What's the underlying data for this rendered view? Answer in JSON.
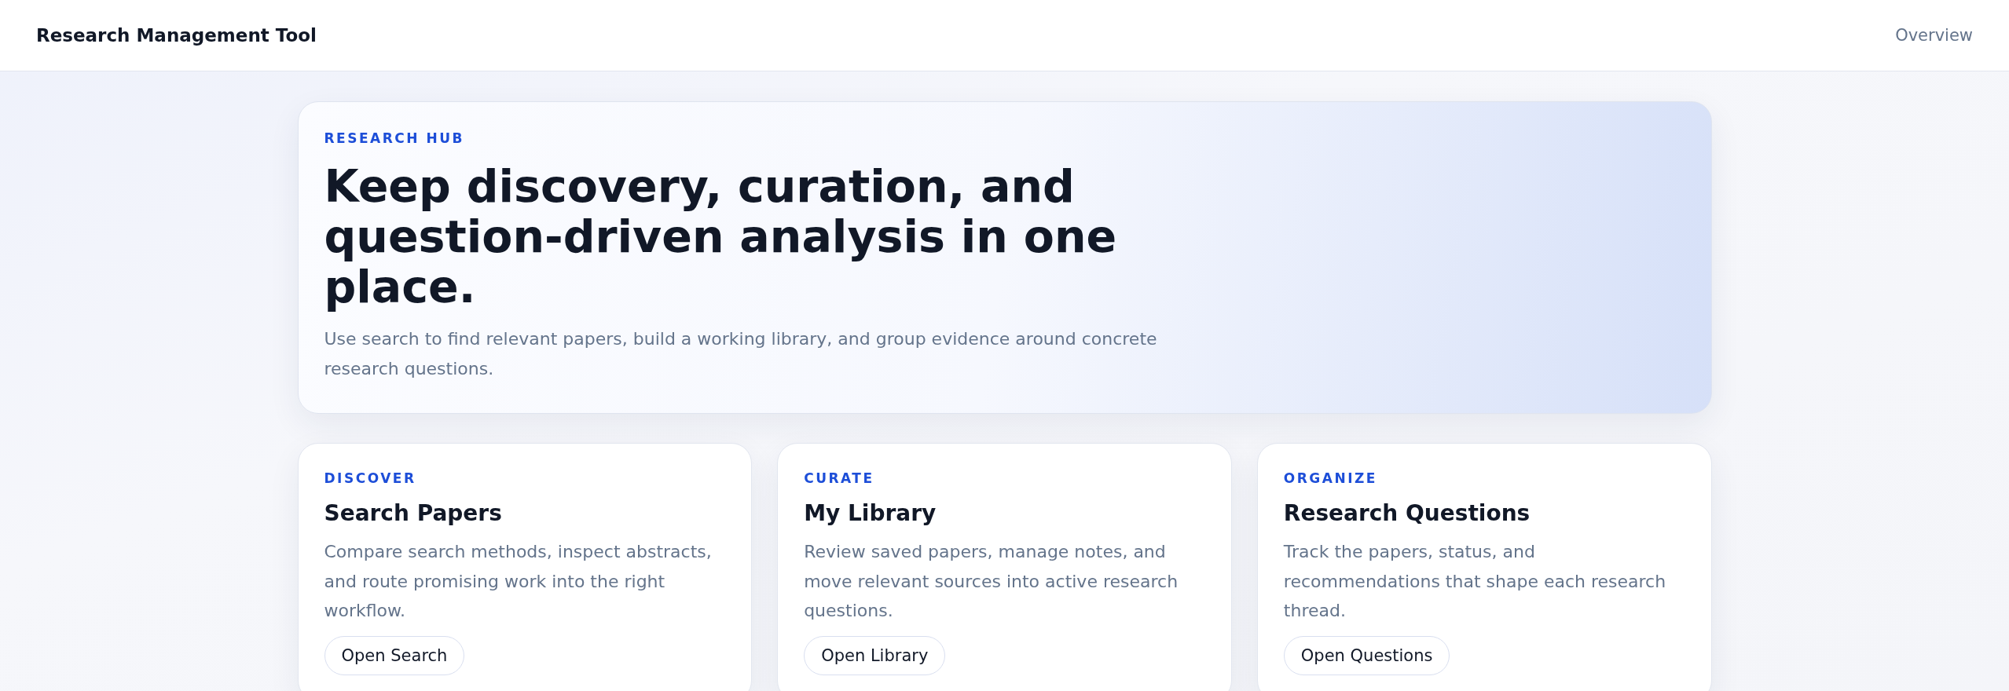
{
  "header": {
    "title": "Research Management Tool",
    "nav": [
      {
        "label": "Overview"
      }
    ]
  },
  "hero": {
    "eyebrow": "RESEARCH HUB",
    "title": "Keep discovery, curation, and question-driven analysis in one place.",
    "description": "Use search to find relevant papers, build a working library, and group evidence around concrete research questions."
  },
  "cards": [
    {
      "eyebrow": "DISCOVER",
      "title": "Search Papers",
      "description": "Compare search methods, inspect abstracts, and route promising work into the right workflow.",
      "button": "Open Search"
    },
    {
      "eyebrow": "CURATE",
      "title": "My Library",
      "description": "Review saved papers, manage notes, and move relevant sources into active research questions.",
      "button": "Open Library"
    },
    {
      "eyebrow": "ORGANIZE",
      "title": "Research Questions",
      "description": "Track the papers, status, and recommendations that shape each research thread.",
      "button": "Open Questions"
    }
  ]
}
